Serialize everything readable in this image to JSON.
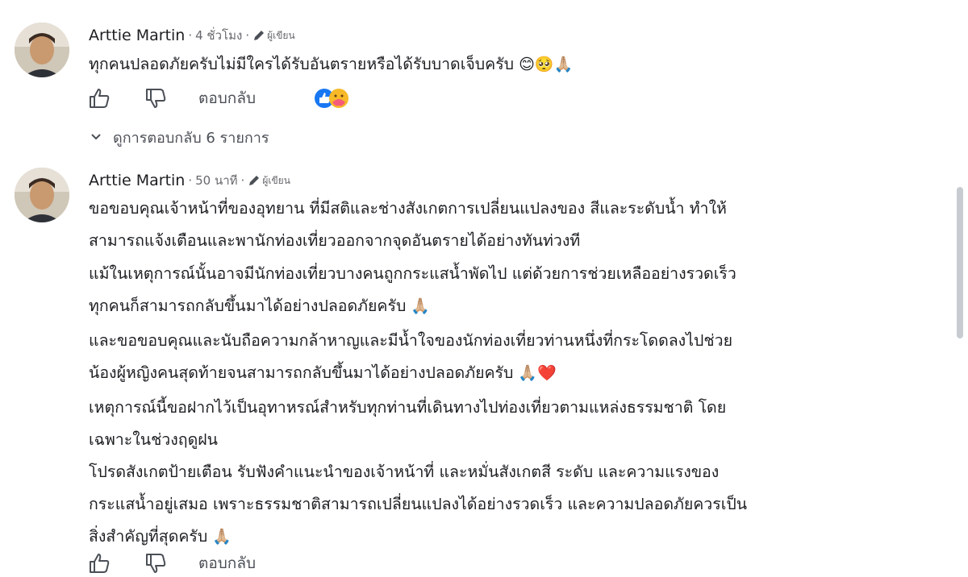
{
  "comments": [
    {
      "author": "Arttie Martin",
      "time": "4 ชั่วโมง",
      "author_badge": "ผู้เขียน",
      "paragraphs": [
        {
          "text": "ทุกคนปลอดภัยครับไม่มีใครได้รับอันตรายหรือได้รับบาดเจ็บครับ",
          "emoji": "😊🥺🙏🏼"
        }
      ],
      "actions": {
        "like_icon": "thumbs-up-icon",
        "dislike_icon": "thumbs-down-icon",
        "reply_label": "ตอบกลับ"
      },
      "reactions": [
        "like",
        "care"
      ],
      "view_replies_label": "ดูการตอบกลับ 6 รายการ"
    },
    {
      "author": "Arttie Martin",
      "time": "50 นาที",
      "author_badge": "ผู้เขียน",
      "paragraphs": [
        {
          "text": "ขอขอบคุณเจ้าหน้าที่ของอุทยาน ที่มีสติและช่างสังเกตการเปลี่ยนแปลงของ สีและระดับน้ำ ทำให้\nสามารถแจ้งเตือนและพานักท่องเที่ยวออกจากจุดอันตรายได้อย่างทันท่วงที",
          "emoji": ""
        },
        {
          "text": "แม้ในเหตุการณ์นั้นอาจมีนักท่องเที่ยวบางคนถูกกระแสน้ำพัดไป แต่ด้วยการช่วยเหลืออย่างรวดเร็ว\nทุกคนก็สามารถกลับขึ้นมาได้อย่างปลอดภัยครับ",
          "emoji": "🙏🏼"
        },
        {
          "text": "และขอขอบคุณและนับถือความกล้าหาญและมีน้ำใจของนักท่องเที่ยวท่านหนึ่งที่กระโดดลงไปช่วย\nน้องผู้หญิงคนสุดท้ายจนสามารถกลับขึ้นมาได้อย่างปลอดภัยครับ",
          "emoji": "🙏🏼❤️"
        },
        {
          "text": "เหตุการณ์นี้ขอฝากไว้เป็นอุทาหรณ์สำหรับทุกท่านที่เดินทางไปท่องเที่ยวตามแหล่งธรรมชาติ โดย\nเฉพาะในช่วงฤดูฝน",
          "emoji": ""
        },
        {
          "text": "โปรดสังเกตป้ายเตือน รับฟังคำแนะนำของเจ้าหน้าที่ และหมั่นสังเกตสี ระดับ และความแรงของ\nกระแสน้ำอยู่เสมอ เพราะธรรมชาติสามารถเปลี่ยนแปลงได้อย่างรวดเร็ว และความปลอดภัยควรเป็น\nสิ่งสำคัญที่สุดครับ",
          "emoji": "🙏🏼"
        }
      ],
      "actions": {
        "like_icon": "thumbs-up-icon",
        "dislike_icon": "thumbs-down-icon",
        "reply_label": "ตอบกลับ"
      }
    }
  ]
}
